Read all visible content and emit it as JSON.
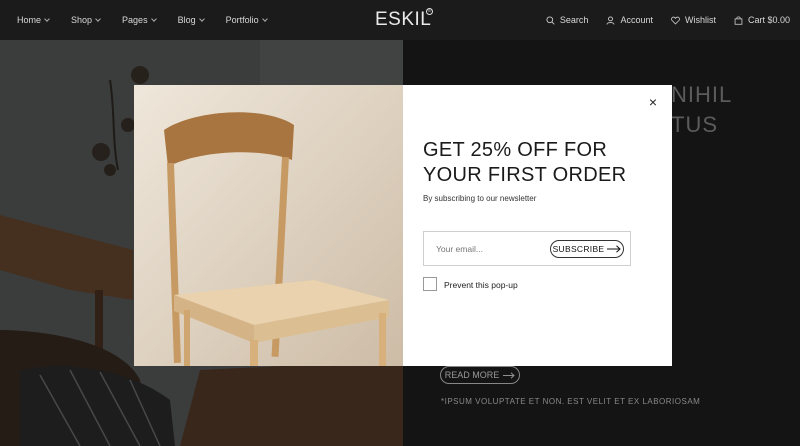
{
  "header": {
    "nav": [
      {
        "label": "Home",
        "has_menu": true
      },
      {
        "label": "Shop",
        "has_menu": true
      },
      {
        "label": "Pages",
        "has_menu": true
      },
      {
        "label": "Blog",
        "has_menu": true
      },
      {
        "label": "Portfolio",
        "has_menu": true
      }
    ],
    "logo": "ESKIL",
    "logo_mark": "®",
    "search_label": "Search",
    "account_label": "Account",
    "wishlist_label": "Wishlist",
    "cart_label": "Cart $0.00"
  },
  "hero": {
    "title_lines": [
      "NIHIL",
      "TUS"
    ],
    "read_more_label": "READ MORE",
    "footnote": "*IPSUM VOLUPTATE ET NON. EST VELIT ET EX LABORIOSAM"
  },
  "popup": {
    "title": "GET 25% OFF FOR YOUR FIRST ORDER",
    "subtitle": "By subscribing to our newsletter",
    "email_placeholder": "Your email...",
    "subscribe_label": "SUBSCRIBE",
    "prevent_label": "Prevent this pop-up",
    "prevent_checked": false,
    "close_glyph": "×"
  },
  "colors": {
    "header_bg": "#1b1b1b",
    "hero_right_bg": "#1f1f1f",
    "modal_bg": "#ffffff"
  }
}
